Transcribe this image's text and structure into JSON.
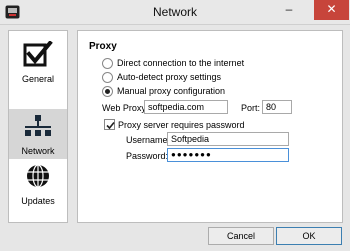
{
  "window": {
    "title": "Network",
    "minimize_glyph": "–",
    "maximize_glyph": "□",
    "close_glyph": "✕"
  },
  "nav": {
    "items": [
      {
        "label": "General",
        "icon": "checkbox-icon"
      },
      {
        "label": "Network",
        "icon": "network-icon",
        "selected": true
      },
      {
        "label": "Updates",
        "icon": "globe-icon"
      }
    ]
  },
  "proxy": {
    "section_title": "Proxy",
    "options": [
      {
        "label": "Direct connection to the internet",
        "selected": false
      },
      {
        "label": "Auto-detect proxy settings",
        "selected": false
      },
      {
        "label": "Manual proxy configuration",
        "selected": true
      }
    ],
    "web_proxy_label": "Web Proxy:",
    "web_proxy_value": "softpedia.com",
    "port_label": "Port:",
    "port_value": "80",
    "requires_password_label": "Proxy server requires password",
    "requires_password_checked": true,
    "username_label": "Username:",
    "username_value": "Softpedia",
    "password_label": "Password:",
    "password_value": "●●●●●●●"
  },
  "footer": {
    "cancel_label": "Cancel",
    "ok_label": "OK"
  },
  "colors": {
    "close_button": "#c7453b",
    "focus_border": "#4a90d9",
    "selected_nav": "#d6d6d6"
  }
}
